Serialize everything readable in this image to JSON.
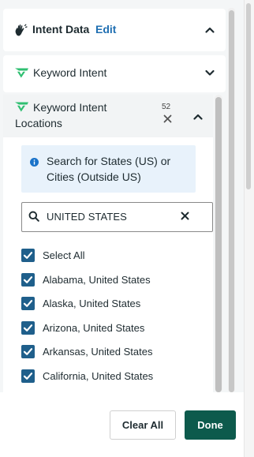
{
  "header": {
    "title": "Intent Data",
    "edit_label": "Edit",
    "icon": "hand-wave-icon",
    "toggle_icon": "chevron-up-icon"
  },
  "keyword_intent": {
    "label": "Keyword Intent",
    "icon": "brand-check-icon",
    "toggle_icon": "chevron-down-icon"
  },
  "locations": {
    "title_line1": "Keyword Intent",
    "title_line2": "Locations",
    "count": "52",
    "clear_icon": "close-icon",
    "toggle_icon": "chevron-up-icon",
    "info": {
      "line1": "Search for States (US) or",
      "line2": "Cities (Outside US)"
    },
    "search": {
      "value": "UNITED STATES",
      "placeholder": ""
    },
    "items": [
      {
        "label": "Select All",
        "checked": true
      },
      {
        "label": "Alabama, United States",
        "checked": true
      },
      {
        "label": "Alaska, United States",
        "checked": true
      },
      {
        "label": "Arizona, United States",
        "checked": true
      },
      {
        "label": "Arkansas, United States",
        "checked": true
      },
      {
        "label": "California, United States",
        "checked": true
      }
    ]
  },
  "footer": {
    "clear_label": "Clear All",
    "done_label": "Done"
  },
  "colors": {
    "accent_green": "#0d5a4c",
    "checkbox_blue": "#1f5f8b",
    "link_blue": "#1f6fb2",
    "brand_green": "#2fbf71",
    "info_bg": "#e8f2fb"
  }
}
